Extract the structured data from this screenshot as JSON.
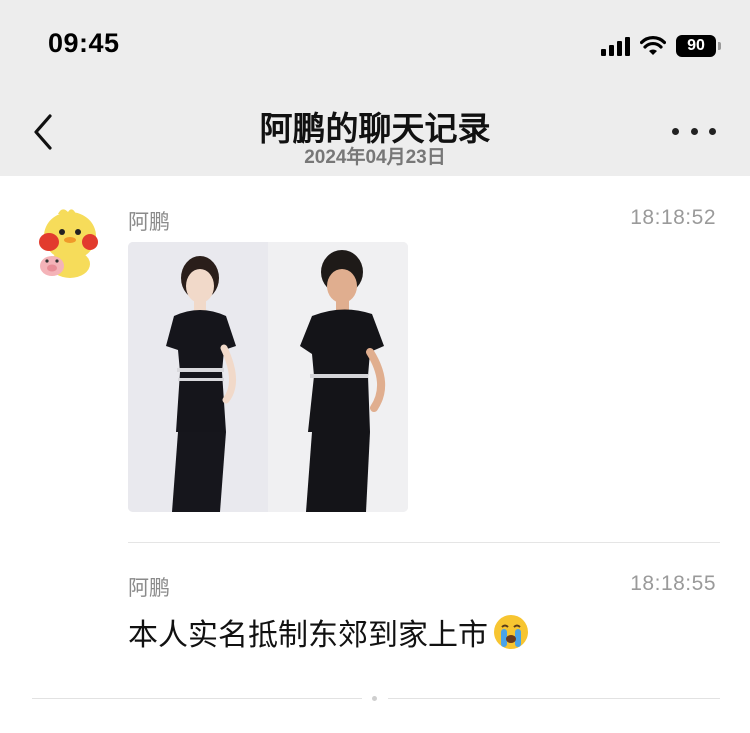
{
  "status_bar": {
    "time": "09:45",
    "battery": "90",
    "icons": [
      "signal-icon",
      "wifi-icon",
      "battery-icon"
    ]
  },
  "header": {
    "title": "阿鹏的聊天记录",
    "date": "2024年04月23日",
    "back_icon": "chevron-left-icon",
    "more_icon": "more-dots-icon"
  },
  "messages": [
    {
      "sender": "阿鹏",
      "time": "18:18:52",
      "type": "image",
      "image": "two-women-in-black-uniforms-photo"
    },
    {
      "sender": "阿鹏",
      "time": "18:18:55",
      "type": "text",
      "text": "本人实名抵制东郊到家上市",
      "emoji": "crying-face-emoji"
    }
  ],
  "colors": {
    "header_bg": "#ededed",
    "page_bg": "#ffffff",
    "meta_text": "#8a8a8a"
  }
}
